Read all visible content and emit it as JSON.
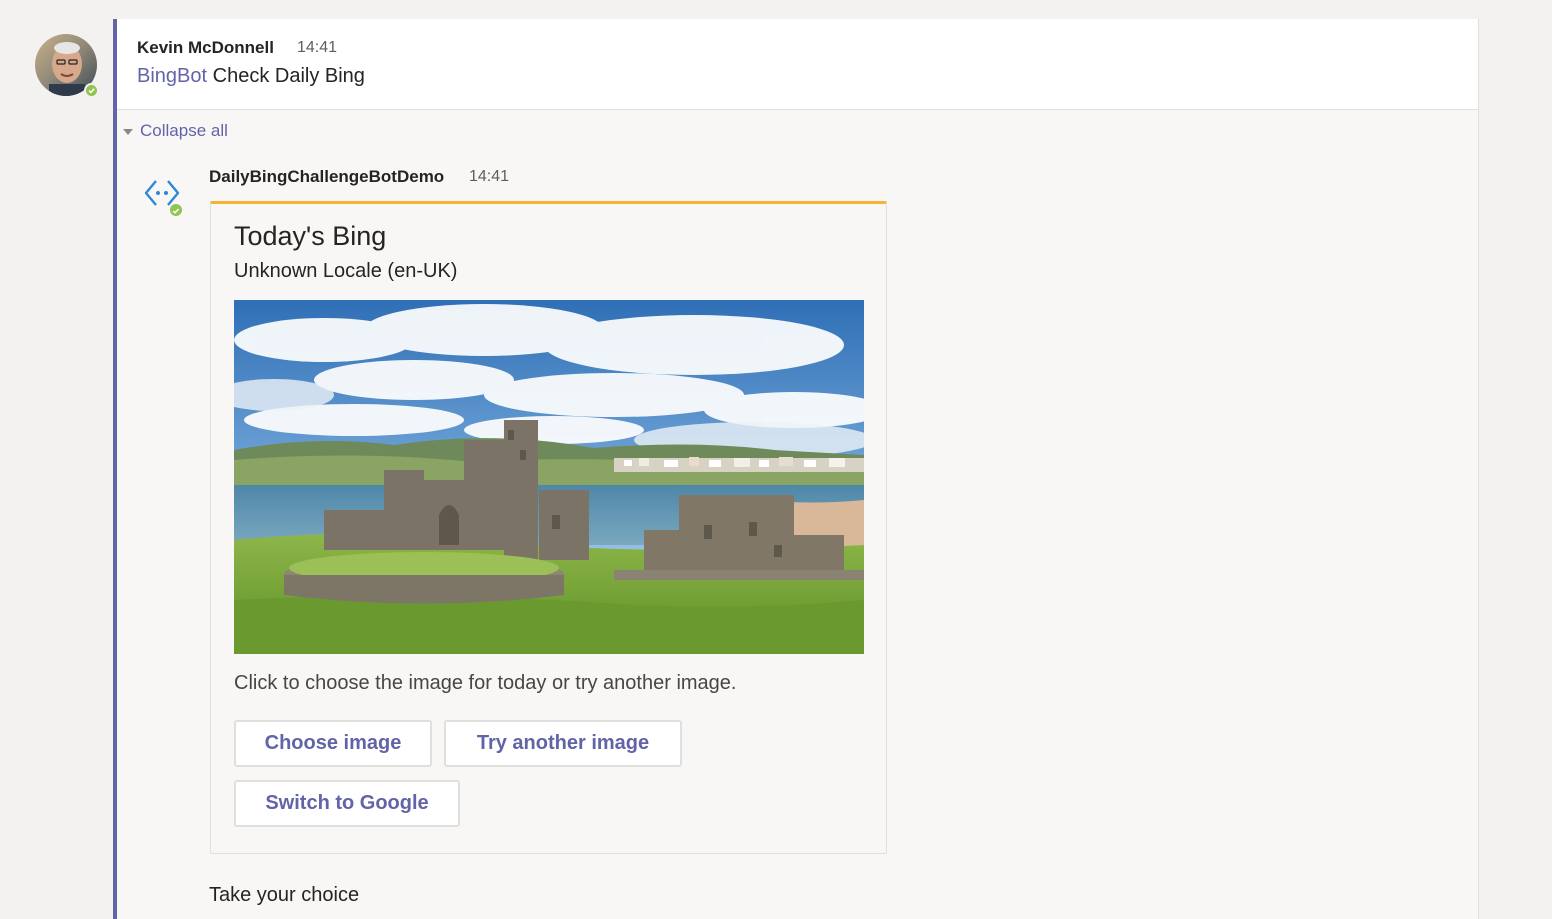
{
  "root_message": {
    "sender": "Kevin McDonnell",
    "time": "14:41",
    "mention": "BingBot",
    "text": "Check Daily Bing",
    "presence": "available"
  },
  "thread": {
    "collapse_label": "Collapse all"
  },
  "bot_message": {
    "sender": "DailyBingChallengeBotDemo",
    "time": "14:41",
    "bot_icon": "bot-diamond-icon",
    "presence": "available",
    "card": {
      "title": "Today's Bing",
      "subtitle": "Unknown Locale (en-UK)",
      "image_description": "castle-on-coast-photo",
      "prompt_text": "Click to choose the image for today or try another image.",
      "buttons": {
        "choose": "Choose image",
        "try_another": "Try another image",
        "switch": "Switch to Google"
      },
      "accent_color": "#f8b236"
    },
    "followup_text": "Take your choice"
  },
  "colors": {
    "brand": "#6264a7",
    "presence_available": "#92c353",
    "card_accent": "#f8b236"
  }
}
